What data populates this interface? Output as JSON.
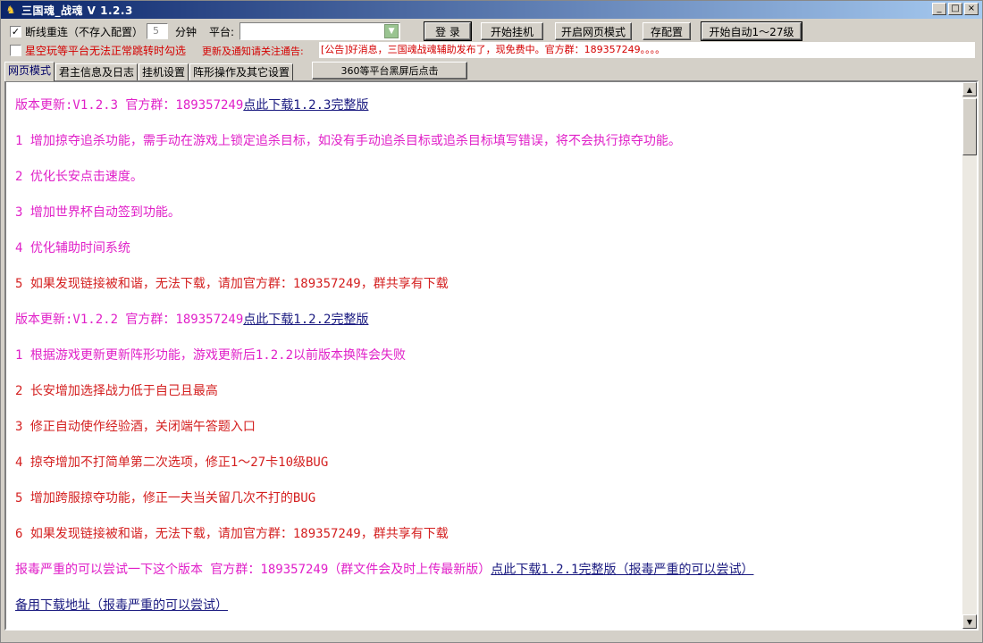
{
  "window": {
    "title": "三国魂_战魂 V 1.2.3",
    "icon": "app-icon",
    "controls": [
      "_",
      "□",
      "×"
    ]
  },
  "toolbar": {
    "reconnect_label": "断线重连（不存入配置）",
    "reconnect_checked": "✓",
    "minutes_value": "5",
    "minutes_label": "分钟",
    "platform_label": "平台:",
    "platform_value": "",
    "login_label": "登 录",
    "start_hangup_label": "开始挂机",
    "web_mode_label": "开启网页模式",
    "save_config_label": "存配置",
    "auto_level_label": "开始自动1～27级"
  },
  "row2": {
    "xingkong_label": "星空玩等平台无法正常跳转时勾选",
    "update_notice_label": "更新及通知请关注通告:",
    "notice_text": "[公告]好消息，三国魂战魂辅助发布了，现免费中。官方群：189357249。。。。"
  },
  "tabs": [
    {
      "label": "网页模式"
    },
    {
      "label": "君主信息及日志"
    },
    {
      "label": "挂机设置"
    },
    {
      "label": "阵形操作及其它设置"
    }
  ],
  "btn360_label": "360等平台黑屏后点击",
  "content": {
    "v123_header": "版本更新:V1.2.3 官方群：189357249",
    "v123_link": "点此下载1.2.3完整版",
    "v123_items": [
      "1 增加掠夺追杀功能，需手动在游戏上锁定追杀目标，如没有手动追杀目标或追杀目标填写错误，将不会执行掠夺功能。",
      "2 优化长安点击速度。",
      "3 增加世界杯自动签到功能。",
      "4 优化辅助时间系统",
      "5 如果发现链接被和谐，无法下载，请加官方群：189357249，群共享有下载"
    ],
    "v122_header": "版本更新:V1.2.2 官方群：189357249",
    "v122_link": "点此下载1.2.2完整版",
    "v122_items": [
      "1 根据游戏更新更新阵形功能，游戏更新后1.2.2以前版本换阵会失败",
      "2 长安增加选择战力低于自己且最高",
      "3 修正自动使作经验酒，关闭端午答题入口",
      "4 掠夺增加不打简单第二次选项，修正1～27卡10级BUG",
      "5 增加跨服掠夺功能，修正一夫当关留几次不打的BUG",
      "6 如果发现链接被和谐，无法下载，请加官方群：189357249，群共享有下载"
    ],
    "v121_text": "报毒严重的可以尝试一下这个版本 官方群：189357249（群文件会及时上传最新版）",
    "v121_link": "点此下载1.2.1完整版（报毒严重的可以尝试）",
    "backup_link": "备用下载地址（报毒严重的可以尝试）"
  },
  "colors": {
    "magenta": "#e020c8",
    "crimson": "#d42020",
    "link": "#1a1a80",
    "titlebar": "#0a246a"
  }
}
